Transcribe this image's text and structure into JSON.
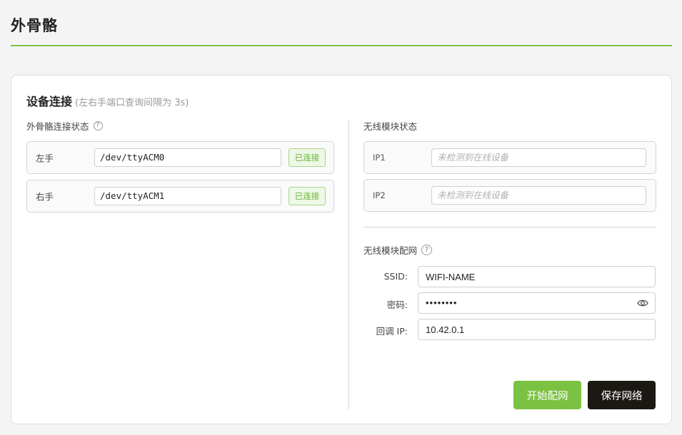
{
  "page": {
    "title": "外骨骼"
  },
  "card": {
    "title": "设备连接",
    "subtitle": "(左右手端口查询间隔为 3s)"
  },
  "exo_status": {
    "label": "外骨骼连接状态",
    "help": "?",
    "rows": [
      {
        "label": "左手",
        "port": "/dev/ttyACM0",
        "status": "已连接"
      },
      {
        "label": "右手",
        "port": "/dev/ttyACM1",
        "status": "已连接"
      }
    ]
  },
  "wireless_status": {
    "label": "无线模块状态",
    "rows": [
      {
        "label": "IP1",
        "placeholder": "未检测到在线设备",
        "value": ""
      },
      {
        "label": "IP2",
        "placeholder": "未检测到在线设备",
        "value": ""
      }
    ]
  },
  "wireless_config": {
    "label": "无线模块配网",
    "help": "?",
    "ssid_label": "SSID:",
    "ssid_value": "WIFI-NAME",
    "password_label": "密码:",
    "password_value": "••••••••",
    "callback_label": "回调 IP:",
    "callback_value": "10.42.0.1",
    "icons": {
      "password_toggle": "eye-icon"
    }
  },
  "actions": {
    "start_label": "开始配网",
    "save_label": "保存网络"
  },
  "colors": {
    "accent": "#7cc242",
    "dark_button": "#1c1814",
    "badge_text": "#6bb33a"
  }
}
